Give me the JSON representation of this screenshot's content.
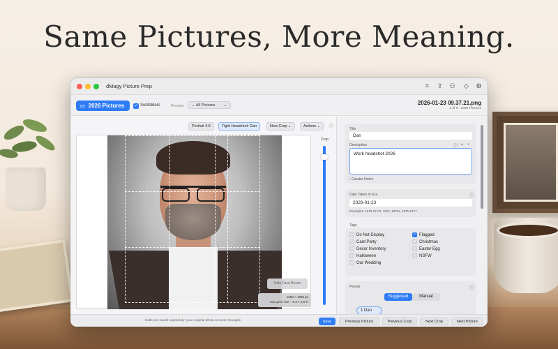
{
  "headline": "Same Pictures, More Meaning.",
  "window": {
    "title": "dMagy Picture Prep",
    "toolbar_icons": [
      "crop-icon",
      "export-icon",
      "people-icon",
      "tag-icon",
      "gear-icon"
    ]
  },
  "toolbar": {
    "folder_label": "2026 Pictures",
    "subfolders_label": "Subfolders",
    "subfolders_checked": true,
    "review_label": "Review:",
    "review_value": "All Pictures",
    "filename": "2026-01-23 09.37.21.png",
    "file_position": "2 of 5 · 2026 Pictures"
  },
  "crop_toolbar": {
    "portrait": "Portrait 4:5",
    "tight_headshot": "Tight Headshot: Dan",
    "new_crop": "New Crop",
    "actions": "Actions"
  },
  "image_overlay": {
    "hide_faces": "Hide Face Boxes",
    "dimensions": "1588 × 1985 px",
    "max_print": "max print size ~ 5.3 × 6.6 in"
  },
  "crop_slider": {
    "label": "Crop",
    "level": 0.95
  },
  "details": {
    "title_label": "Title",
    "title_value": "Dan",
    "description_label": "Description",
    "description_value": "Work headshot 2026",
    "curator_notes": "Curator Notes",
    "date_label": "Date Taken or Era",
    "date_value": "2026-01-23",
    "date_examples": "Examples: 1976-07-04, 1976, 1970s, 1975-1977"
  },
  "tags": {
    "label": "Tags",
    "items": [
      {
        "label": "Do Not Display",
        "checked": false
      },
      {
        "label": "Flagged",
        "checked": true
      },
      {
        "label": "Card Party",
        "checked": false
      },
      {
        "label": "Christmas",
        "checked": false
      },
      {
        "label": "Decor Inventory",
        "checked": false
      },
      {
        "label": "Easter Egg",
        "checked": false
      },
      {
        "label": "Halloween",
        "checked": false
      },
      {
        "label": "NSFW",
        "checked": false
      },
      {
        "label": "Our Wedding",
        "checked": false
      }
    ]
  },
  "people": {
    "label": "People",
    "tabs": [
      "Suggested",
      "Manual"
    ],
    "selected_tab": "Suggested",
    "chip": "1  Dan"
  },
  "footer": {
    "note": "Edits are saved separately; your original photo is never changed.",
    "save": "Save",
    "previous_picture": "Previous Picture",
    "previous_crop": "Previous Crop",
    "next_crop": "Next Crop",
    "next_picture": "Next Picture"
  },
  "colors": {
    "accent": "#2f7cf6"
  }
}
